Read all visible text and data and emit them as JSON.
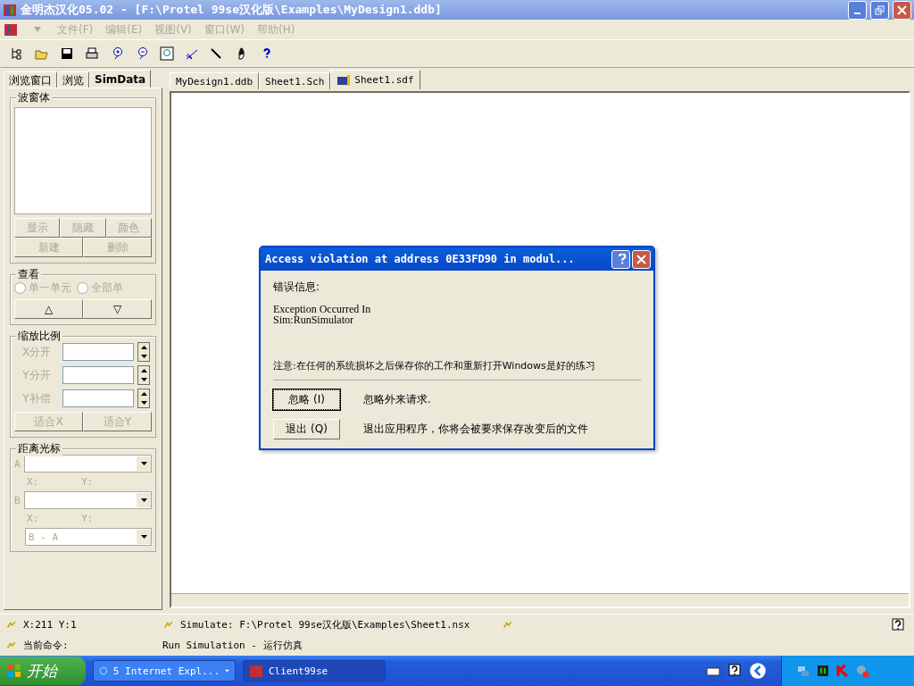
{
  "window": {
    "title": "金明杰汉化05.02 - [F:\\Protel 99se汉化版\\Examples\\MyDesign1.ddb]",
    "active": false
  },
  "menu": [
    {
      "label": "文件(F)",
      "disabled": true
    },
    {
      "label": "编辑(E)",
      "disabled": true
    },
    {
      "label": "视图(V)",
      "disabled": true
    },
    {
      "label": "窗口(W)",
      "disabled": true
    },
    {
      "label": "帮助(H)",
      "disabled": true
    }
  ],
  "left_panel": {
    "tabs": [
      {
        "label": "浏览窗口",
        "selected": false
      },
      {
        "label": "浏览",
        "selected": false
      },
      {
        "label": "SimData",
        "selected": true
      }
    ],
    "waveform": {
      "title": "波窗体",
      "buttons": [
        {
          "label": "显示",
          "disabled": true
        },
        {
          "label": "隐藏",
          "disabled": true
        },
        {
          "label": "颜色",
          "disabled": true
        },
        {
          "label": "新建",
          "disabled": true
        },
        {
          "label": "删除",
          "disabled": true
        }
      ]
    },
    "view": {
      "title": "查看",
      "radios": [
        {
          "label": "单一单元",
          "selected": false,
          "disabled": true
        },
        {
          "label": "全部单",
          "selected": false,
          "disabled": true
        }
      ],
      "buttons": [
        {
          "label": "△",
          "disabled": false
        },
        {
          "label": "▽",
          "disabled": false
        }
      ]
    },
    "scale": {
      "title": "缩放比例",
      "fields": [
        {
          "label": "X分开",
          "disabled": true
        },
        {
          "label": "Y分开",
          "disabled": true
        },
        {
          "label": "Y补偿",
          "disabled": true
        }
      ],
      "buttons": [
        {
          "label": "适合X",
          "disabled": true
        },
        {
          "label": "适合Y",
          "disabled": true
        }
      ]
    },
    "cursor": {
      "title": "距离光标",
      "rows": [
        {
          "label": "A",
          "x_label": "X:",
          "y_label": "Y:"
        },
        {
          "label": "B",
          "x_label": "X:",
          "y_label": "Y:"
        }
      ],
      "difference": {
        "value": "B - A"
      }
    }
  },
  "doc_tabs": [
    {
      "label": "MyDesign1.ddb",
      "selected": false,
      "icon": false
    },
    {
      "label": "Sheet1.Sch",
      "selected": false,
      "icon": false
    },
    {
      "label": "Sheet1.sdf",
      "selected": true,
      "icon": true
    }
  ],
  "dialog": {
    "title": "Access violation at address 0E33FD90 in modul...",
    "label": "错误信息:",
    "message": [
      "Exception Occurred In",
      "Sim:RunSimulator"
    ],
    "note": "注意:在任何的系统损坏之后保存你的工作和重新打开Windows是好的练习",
    "actions": [
      {
        "button": "忽略 (I)",
        "description": "忽略外来请求.",
        "focused": true
      },
      {
        "button": "退出 (Q)",
        "description": "退出应用程序，你将会被要求保存改变后的文件",
        "focused": false
      }
    ]
  },
  "status_bar": {
    "position": "X:211 Y:1",
    "simulate": "Simulate: F:\\Protel 99se汉化版\\Examples\\Sheet1.nsx",
    "command_label": "当前命令:",
    "command": "Run Simulation - 运行仿真"
  },
  "taskbar": {
    "start": "开始",
    "tasks": [
      {
        "label": "5 Internet Expl...",
        "selected": false,
        "group": true
      },
      {
        "label": "Client99se",
        "selected": true,
        "group": false
      }
    ]
  }
}
